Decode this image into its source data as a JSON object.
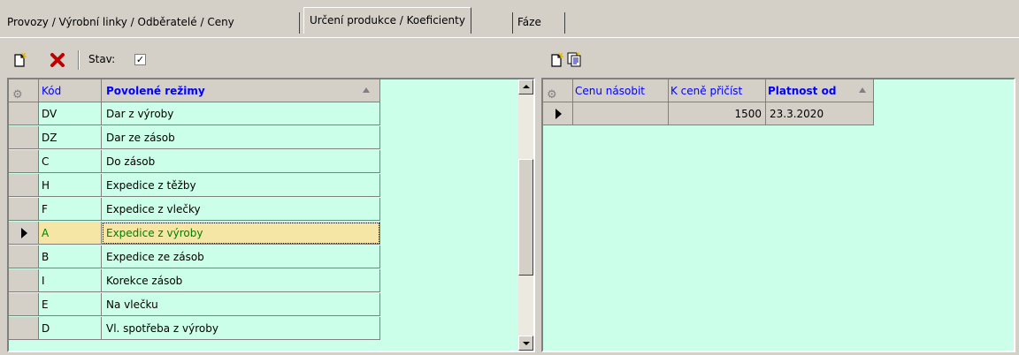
{
  "tabs": [
    {
      "label": "Provozy / Výrobní linky / Odběratelé / Ceny"
    },
    {
      "label": "Určení produkce / Koeficienty"
    },
    {
      "label": "Fáze"
    }
  ],
  "left_toolbar": {
    "new_icon": "new-document-icon",
    "delete_icon": "delete-x-icon",
    "stav_label": "Stav:",
    "stav_checked": "✓"
  },
  "right_toolbar": {
    "new_icon": "new-document-icon",
    "copy_icon": "copy-document-icon"
  },
  "left_grid": {
    "columns": [
      "Kód",
      "Povolené režimy"
    ],
    "rows": [
      {
        "code": "DV",
        "mode": "Dar z výroby"
      },
      {
        "code": "DZ",
        "mode": "Dar ze zásob"
      },
      {
        "code": "C",
        "mode": "Do zásob"
      },
      {
        "code": "H",
        "mode": "Expedice z těžby"
      },
      {
        "code": "F",
        "mode": "Expedice z vlečky"
      },
      {
        "code": "A",
        "mode": "Expedice z výroby"
      },
      {
        "code": "B",
        "mode": "Expedice ze zásob"
      },
      {
        "code": "I",
        "mode": "Korekce zásob"
      },
      {
        "code": "E",
        "mode": "Na vlečku"
      },
      {
        "code": "D",
        "mode": "Vl. spotřeba z výroby"
      }
    ],
    "selected_index": 5
  },
  "right_grid": {
    "columns": [
      "Cenu násobit",
      "K ceně přičíst",
      "Platnost od"
    ],
    "rows": [
      {
        "multiply": "",
        "add": "1500",
        "valid_from": "23.3.2020"
      }
    ]
  },
  "colors": {
    "grid_bg": "#ccffe9",
    "selected_row": "#f5e6a5",
    "header_blue": "#0000ff"
  }
}
